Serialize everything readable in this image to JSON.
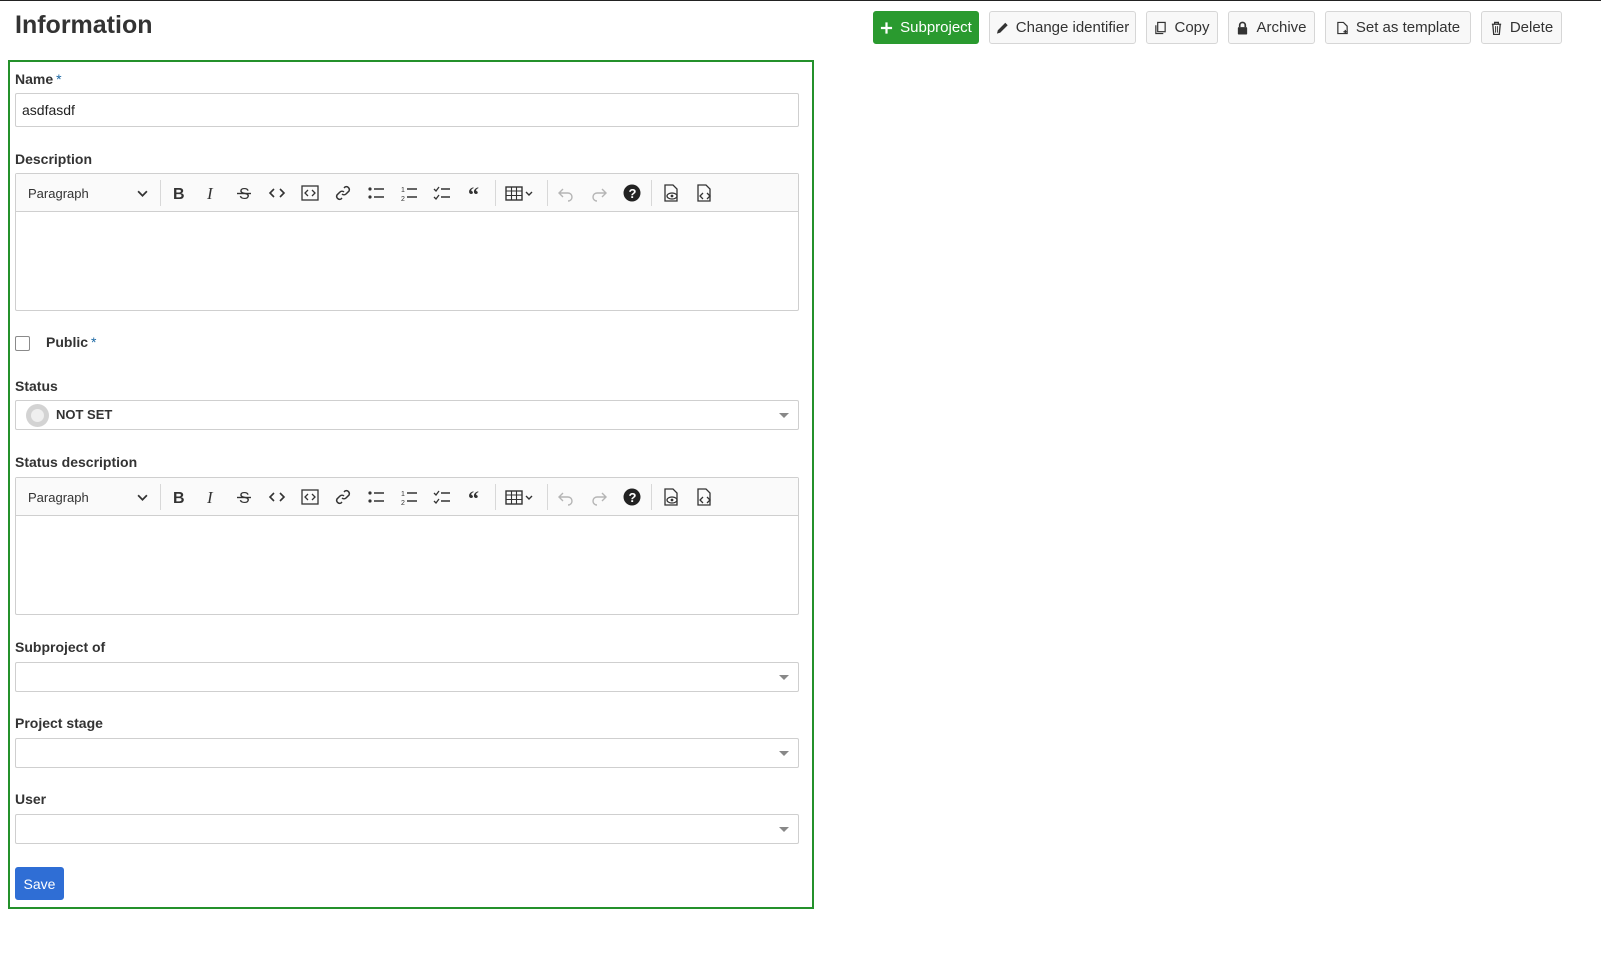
{
  "page": {
    "title": "Information"
  },
  "toolbar": {
    "subproject": "Subproject",
    "change_identifier": "Change identifier",
    "copy": "Copy",
    "archive": "Archive",
    "set_as_template": "Set as template",
    "delete": "Delete"
  },
  "form": {
    "name_label": "Name",
    "required_mark": "*",
    "name_value": "asdfasdf",
    "description_label": "Description",
    "editor_block_style": "Paragraph",
    "public_label": "Public",
    "public_checked": false,
    "status_label": "Status",
    "status_value": "NOT SET",
    "status_description_label": "Status description",
    "subproject_of_label": "Subproject of",
    "subproject_of_value": "",
    "project_stage_label": "Project stage",
    "project_stage_value": "",
    "user_label": "User",
    "user_value": "",
    "save_label": "Save"
  },
  "colors": {
    "primary_green": "#2a9a2f",
    "panel_border": "#24912b",
    "save_blue": "#2f6ed5",
    "required_blue": "#1a67a3"
  },
  "icons": {
    "toolbar": [
      "plus-icon",
      "pencil-icon",
      "copy-icon",
      "lock-icon",
      "template-icon",
      "trash-icon"
    ],
    "editor": [
      "bold-icon",
      "italic-icon",
      "strikethrough-icon",
      "inline-code-icon",
      "code-block-icon",
      "link-icon",
      "bulleted-list-icon",
      "numbered-list-icon",
      "todo-list-icon",
      "blockquote-icon",
      "table-icon",
      "undo-icon",
      "redo-icon",
      "help-icon",
      "preview-icon",
      "source-icon"
    ]
  }
}
